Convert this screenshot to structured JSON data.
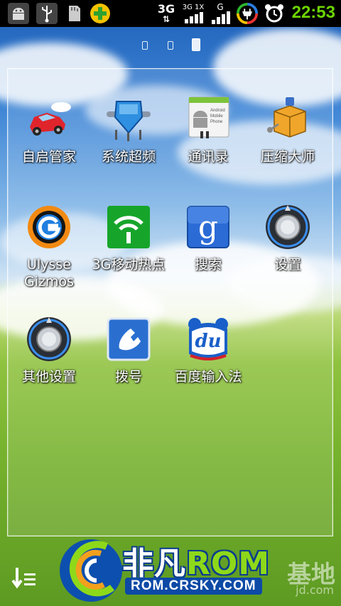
{
  "status_bar": {
    "time": "22:53",
    "icons": [
      "android-icon",
      "usb-icon",
      "sd-card-icon",
      "plus-app-icon",
      "3g-data-icon",
      "3g-1x-icon",
      "signal-icon",
      "battery-icon",
      "alarm-icon"
    ],
    "network_label": "3G",
    "network_sub_label": "3G 1X",
    "signal_label": "G"
  },
  "page_indicator": {
    "pages": 3,
    "active": 2
  },
  "folder": {
    "apps": [
      {
        "label": "自启管家",
        "icon": "car-icon"
      },
      {
        "label": "系统超频",
        "icon": "shield-icon"
      },
      {
        "label": "通讯录",
        "icon": "contacts-icon",
        "icon_text": "Android Mobile Phone"
      },
      {
        "label": "压缩大师",
        "icon": "archive-box-icon"
      },
      {
        "label": "Ulysse Gizmos",
        "icon": "ulysse-g-icon"
      },
      {
        "label": "3G移动热点",
        "icon": "wifi-hotspot-icon"
      },
      {
        "label": "搜索",
        "icon": "google-search-icon",
        "icon_text": "g"
      },
      {
        "label": "设置",
        "icon": "settings-knob-icon"
      },
      {
        "label": "其他设置",
        "icon": "settings-knob-icon"
      },
      {
        "label": "拨号",
        "icon": "phone-icon"
      },
      {
        "label": "百度输入法",
        "icon": "baidu-du-icon",
        "icon_text": "du"
      }
    ]
  },
  "bottom": {
    "logo_main_1": "非凡",
    "logo_main_2": "ROM",
    "logo_sub": "ROM.CRSKY.COM",
    "watermark": "基地",
    "watermark_sub": "jd.com"
  },
  "colors": {
    "clock": "#6cd400",
    "status_bar_bg": "#000000"
  }
}
